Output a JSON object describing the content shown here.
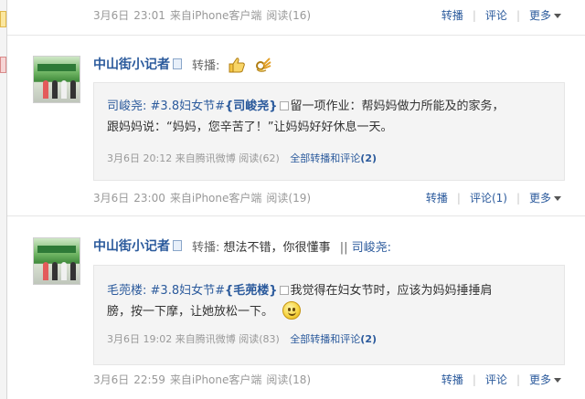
{
  "feed": {
    "rows": [
      {
        "meta": {
          "date": "3月6日",
          "time": "23:01",
          "source": "来自iPhone客户端",
          "reads": "阅读(16)",
          "repost": "转播",
          "comment": "评论",
          "more": "更多"
        }
      }
    ],
    "posts": [
      {
        "author": "中山街小记者",
        "repost_label": "转播:",
        "quote": {
          "author": "司峻尧:",
          "hashtag": "#3.8妇女节#",
          "mention": "{司峻尧}",
          "text_line1": "留一项作业：帮妈妈做力所能及的家务，",
          "text_line2": "跟妈妈说：“妈妈，您辛苦了！”让妈妈好好休息一天。",
          "meta": {
            "date": "3月6日",
            "time": "20:12",
            "source": "来自腾讯微博",
            "reads": "阅读(62)",
            "all_link": "全部转播和评论",
            "count": "(2)"
          }
        },
        "meta": {
          "date": "3月6日",
          "time": "23:00",
          "source": "来自iPhone客户端",
          "reads": "阅读(19)",
          "repost": "转播",
          "comment": "评论(1)",
          "more": "更多"
        }
      },
      {
        "author": "中山街小记者",
        "repost_label": "转播:",
        "text": "想法不错，你很懂事",
        "separator": "||",
        "mention": "司峻尧:",
        "quote": {
          "author": "毛蔸楼:",
          "hashtag": "#3.8妇女节#",
          "mention": "{毛蔸楼}",
          "text_line1": "我觉得在妇女节时，应该为妈妈捶捶肩",
          "text_line2": "膀，按一下摩，让她放松一下。",
          "meta": {
            "date": "3月6日",
            "time": "19:02",
            "source": "来自腾讯微博",
            "reads": "阅读(83)",
            "all_link": "全部转播和评论",
            "count": "(2)"
          }
        },
        "meta": {
          "date": "3月6日",
          "time": "22:59",
          "source": "来自iPhone客户端",
          "reads": "阅读(18)",
          "repost": "转播",
          "comment": "评论",
          "more": "更多"
        }
      }
    ]
  },
  "icons": [
    "thumbs-up-emoji",
    "smiley-emoji",
    "verified-badge-icon",
    "more-arrow-icon"
  ]
}
